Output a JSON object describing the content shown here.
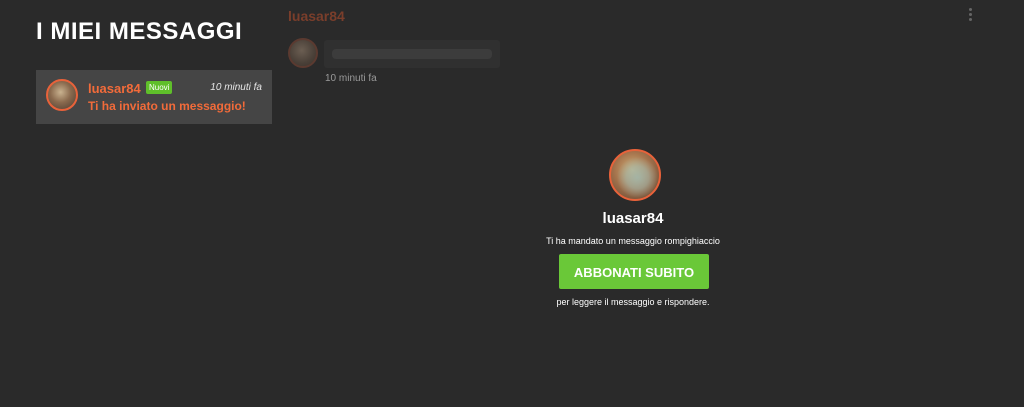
{
  "sidebar": {
    "title": "I MIEI MESSAGGI",
    "conversations": [
      {
        "username": "luasar84",
        "badge": "Nuovi",
        "time": "10 minuti fa",
        "preview": "Ti ha inviato un messaggio!"
      }
    ]
  },
  "chat": {
    "header_username": "luasar84",
    "message": {
      "time": "10 minuti fa"
    }
  },
  "promo": {
    "username": "luasar84",
    "subtitle": "Ti ha mandato un messaggio rompighiaccio",
    "button_label": "ABBONATI SUBITO",
    "footer": "per leggere il messaggio e rispondere."
  },
  "icons": {
    "menu": "kebab-menu-icon"
  },
  "colors": {
    "background": "#2a2a2a",
    "accent": "#f26b3a",
    "badge": "#5fbf2a",
    "button": "#6ac838"
  }
}
